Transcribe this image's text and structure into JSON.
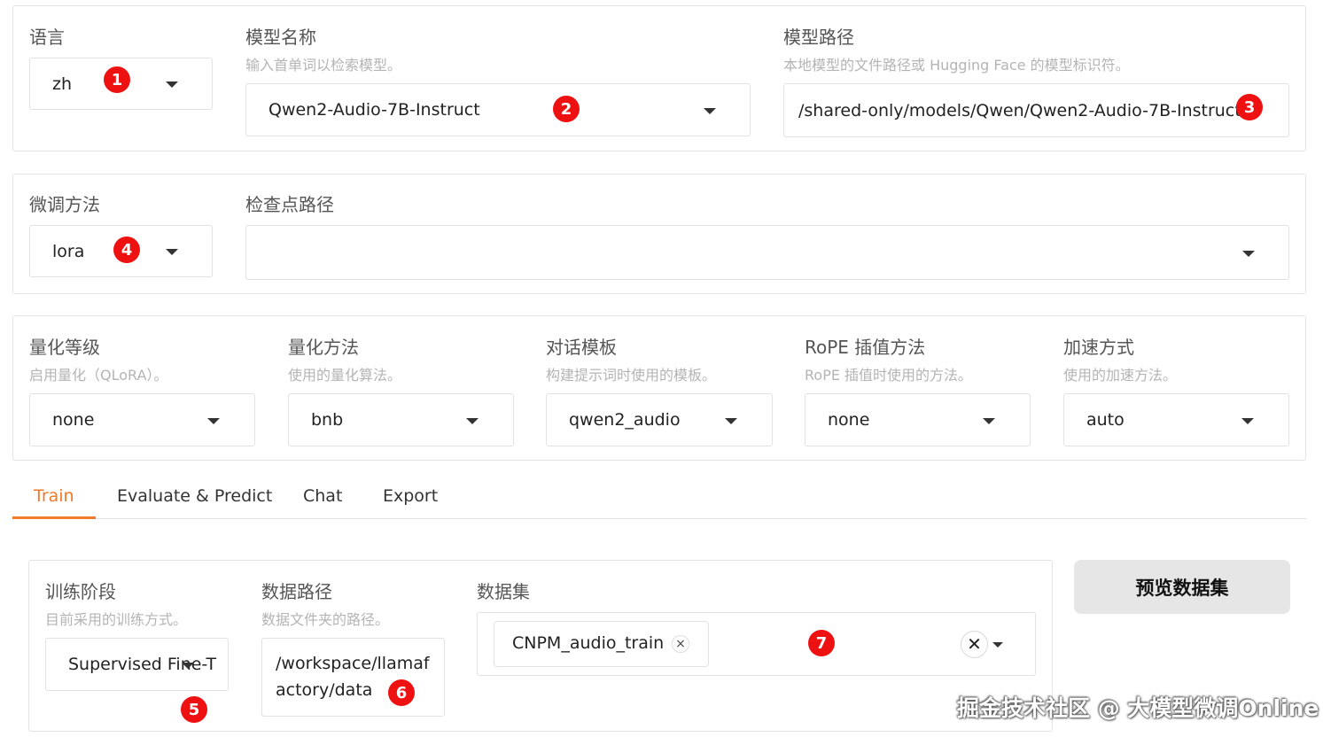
{
  "model": {
    "language": {
      "label": "语言",
      "value": "zh"
    },
    "model_name": {
      "label": "模型名称",
      "hint": "输入首单词以检索模型。",
      "value": "Qwen2-Audio-7B-Instruct"
    },
    "model_path": {
      "label": "模型路径",
      "hint": "本地模型的文件路径或 Hugging Face 的模型标识符。",
      "value": "/shared-only/models/Qwen/Qwen2-Audio-7B-Instruct"
    }
  },
  "finetune": {
    "method": {
      "label": "微调方法",
      "value": "lora"
    },
    "checkpoint": {
      "label": "检查点路径",
      "value": ""
    }
  },
  "advanced": {
    "quant_bit": {
      "label": "量化等级",
      "hint": "启用量化（QLoRA）。",
      "value": "none"
    },
    "quant_method": {
      "label": "量化方法",
      "hint": "使用的量化算法。",
      "value": "bnb"
    },
    "template": {
      "label": "对话模板",
      "hint": "构建提示词时使用的模板。",
      "value": "qwen2_audio"
    },
    "rope": {
      "label": "RoPE 插值方法",
      "hint": "RoPE 插值时使用的方法。",
      "value": "none"
    },
    "booster": {
      "label": "加速方式",
      "hint": "使用的加速方法。",
      "value": "auto"
    }
  },
  "tabs": [
    "Train",
    "Evaluate & Predict",
    "Chat",
    "Export"
  ],
  "train": {
    "stage": {
      "label": "训练阶段",
      "hint": "目前采用的训练方式。",
      "value": "Supervised Fine-T"
    },
    "dataset_dir": {
      "label": "数据路径",
      "hint": "数据文件夹的路径。",
      "value_line1": "/workspace/llamaf",
      "value_line2": "actory/data"
    },
    "dataset": {
      "label": "数据集",
      "chips": [
        "CNPM_audio_train"
      ],
      "chip_remove": "×",
      "clear": "✕"
    },
    "preview_button": "预览数据集"
  },
  "badges": [
    "1",
    "2",
    "3",
    "4",
    "5",
    "6",
    "7"
  ],
  "watermark": "掘金技术社区 @ 大模型微调Online",
  "colors": {
    "active_tab": "#ee7a2a",
    "badge": "#ee1111",
    "border": "#e3e3e3",
    "hint_text": "#b4b4b4",
    "button_bg": "#e6e6e6"
  }
}
